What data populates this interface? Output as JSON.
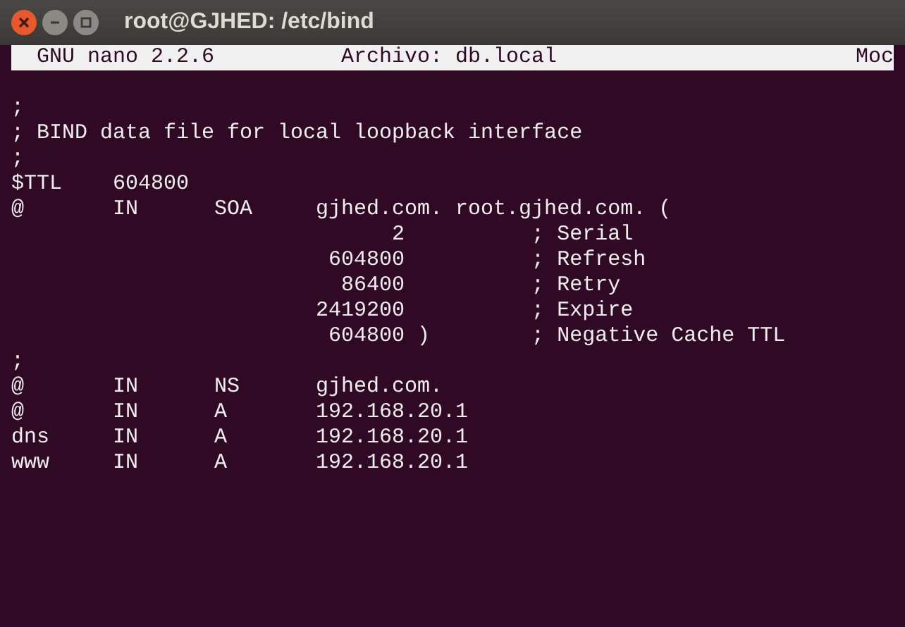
{
  "window": {
    "title": "root@GJHED: /etc/bind"
  },
  "nano_header": {
    "version": "GNU nano 2.2.6",
    "file": "Archivo: db.local",
    "status": "Moc"
  },
  "lines": [
    ";",
    "; BIND data file for local loopback interface",
    ";",
    "$TTL    604800",
    "@       IN      SOA     gjhed.com. root.gjhed.com. (",
    "                              2          ; Serial",
    "                         604800          ; Refresh",
    "                          86400          ; Retry",
    "                        2419200          ; Expire",
    "                         604800 )        ; Negative Cache TTL",
    ";",
    "@       IN      NS      gjhed.com.",
    "@       IN      A       192.168.20.1",
    "dns     IN      A       192.168.20.1",
    "www     IN      A       192.168.20.1"
  ]
}
